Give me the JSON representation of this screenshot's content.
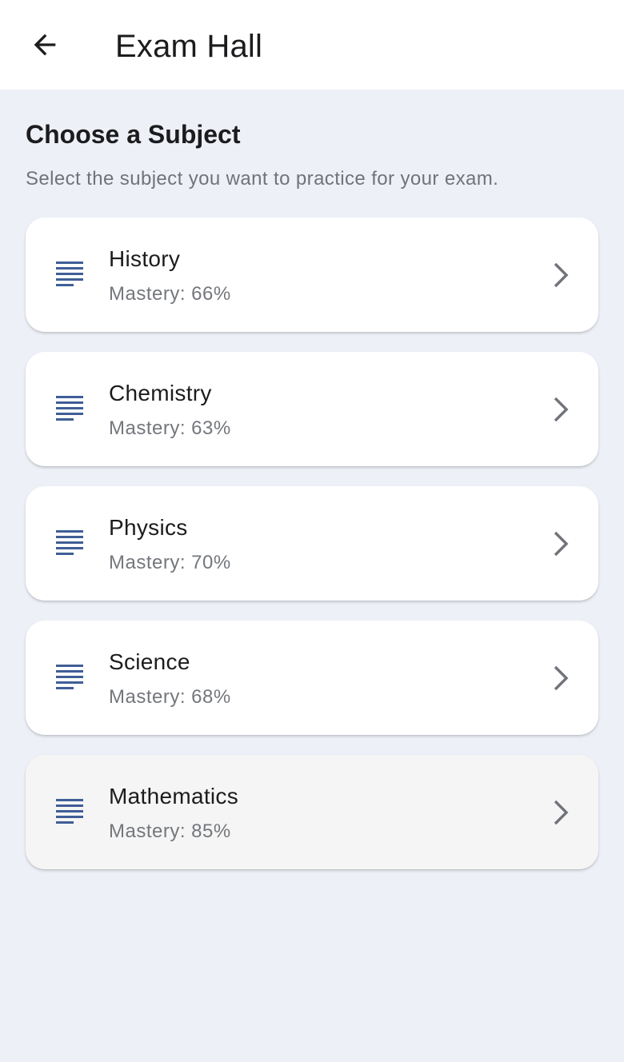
{
  "app_bar": {
    "title": "Exam Hall",
    "back_icon": "arrow-back-icon"
  },
  "header": {
    "title": "Choose a Subject",
    "subtitle": "Select the subject you want to practice for your exam."
  },
  "subjects": [
    {
      "name": "History",
      "mastery": "Mastery: 66%",
      "icon": "notes-lines-icon"
    },
    {
      "name": "Chemistry",
      "mastery": "Mastery: 63%",
      "icon": "notes-lines-icon"
    },
    {
      "name": "Physics",
      "mastery": "Mastery: 70%",
      "icon": "notes-lines-icon"
    },
    {
      "name": "Science",
      "mastery": "Mastery: 68%",
      "icon": "notes-lines-icon"
    },
    {
      "name": "Mathematics",
      "mastery": "Mastery: 85%",
      "icon": "notes-lines-icon"
    }
  ],
  "colors": {
    "background": "#edf0f7",
    "card": "#ffffff",
    "card_pressed": "#f5f5f5",
    "icon_accent": "#3f5e96",
    "chevron": "#707379"
  }
}
